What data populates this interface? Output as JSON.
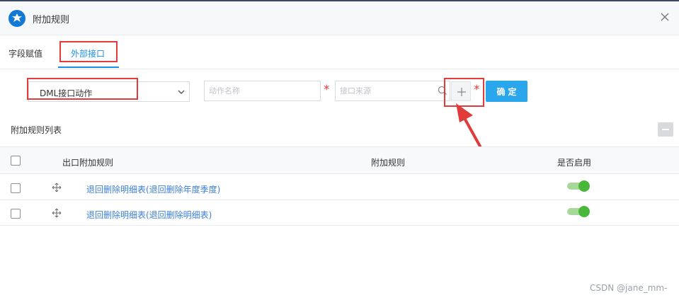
{
  "dialog": {
    "title": "附加规则"
  },
  "tabs": [
    {
      "label": "字段赋值"
    },
    {
      "label": "外部接口"
    }
  ],
  "form": {
    "action_type": "DML接口动作",
    "action_name_placeholder": "动作名称",
    "source_placeholder": "接口来源",
    "required_mark": "*",
    "confirm_label": "确定"
  },
  "list": {
    "title": "附加规则列表",
    "columns": [
      "出口附加规则",
      "附加规则",
      "是否启用"
    ],
    "rows": [
      {
        "name": "退回删除明细表(退回删除年度季度)",
        "enabled": true
      },
      {
        "name": "退回删除明细表(退回删除明细表)",
        "enabled": true
      }
    ]
  },
  "watermark": "CSDN @jane_mm-",
  "colors": {
    "accent": "#1890e8",
    "confirm": "#2aa7ec",
    "annotation": "#e23b3b",
    "toggle_on": "#49b83a"
  }
}
